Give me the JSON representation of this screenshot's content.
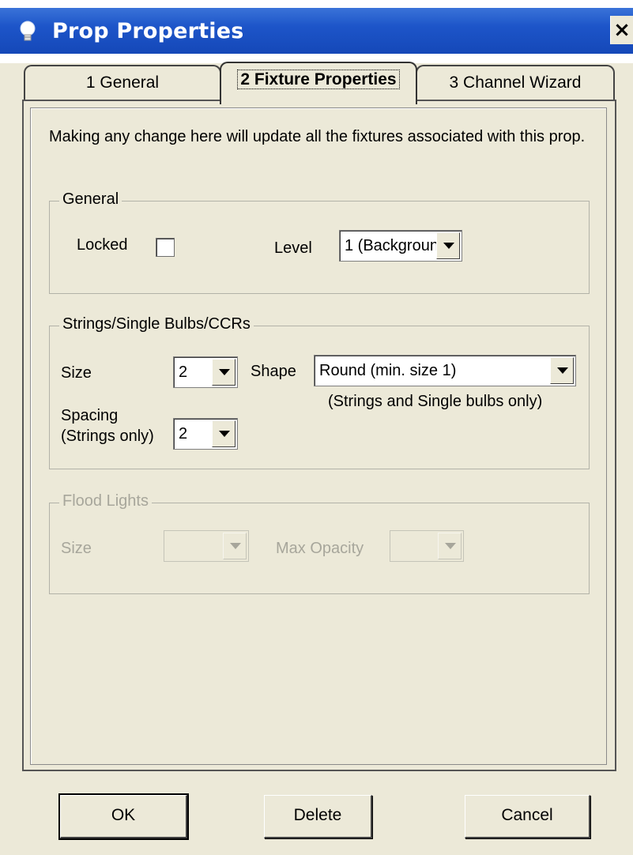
{
  "window": {
    "title": "Prop Properties",
    "close_glyph": "×"
  },
  "tabs": [
    {
      "label": "1 General",
      "active": false
    },
    {
      "label": "2 Fixture Properties",
      "active": true
    },
    {
      "label": "3 Channel Wizard",
      "active": false
    }
  ],
  "intro_text": "Making any change here will update all the fixtures associated with this prop.",
  "general_group": {
    "legend": "General",
    "locked_label": "Locked",
    "locked_checked": false,
    "level_label": "Level",
    "level_value": "1 (Backgroun"
  },
  "strings_group": {
    "legend": "Strings/Single Bulbs/CCRs",
    "size_label": "Size",
    "size_value": "2",
    "shape_label": "Shape",
    "shape_value": "Round (min. size 1)",
    "shape_note": "(Strings and Single bulbs only)",
    "spacing_label_line1": "Spacing",
    "spacing_label_line2": "(Strings only)",
    "spacing_value": "2"
  },
  "flood_group": {
    "legend": "Flood Lights",
    "size_label": "Size",
    "size_value": "",
    "max_opacity_label": "Max Opacity",
    "max_opacity_value": ""
  },
  "buttons": {
    "ok": "OK",
    "delete": "Delete",
    "cancel": "Cancel"
  },
  "colors": {
    "titlebar": "#1d55c9",
    "dialog_bg": "#ece9d8",
    "disabled_text": "#a7a69b"
  },
  "icons": {
    "title_icon": "lightbulb-icon",
    "combo_arrow": "chevron-down-icon"
  }
}
